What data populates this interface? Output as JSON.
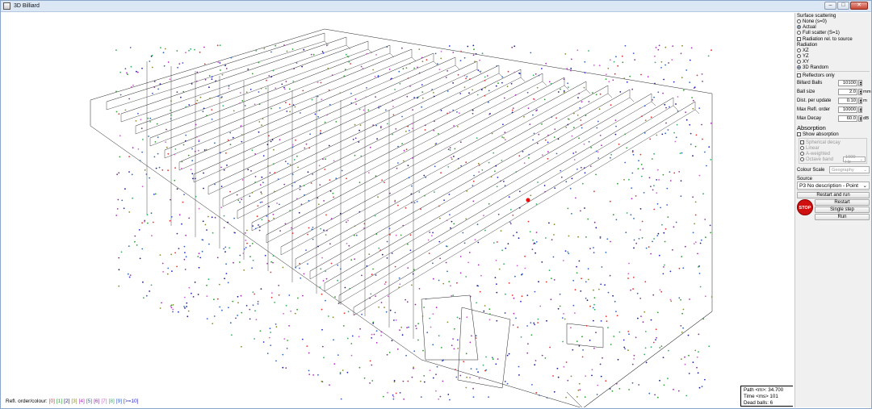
{
  "window": {
    "title": "3D Billiard",
    "minimize": "–",
    "maximize": "□",
    "close": "✕"
  },
  "legend": {
    "prefix": "Refl. order/colour:",
    "items": [
      {
        "label": "[0]",
        "color": "#e8302a"
      },
      {
        "label": "[1]",
        "color": "#2aa02a"
      },
      {
        "label": "[2]",
        "color": "#1a1a8c"
      },
      {
        "label": "[3]",
        "color": "#8a8a2a"
      },
      {
        "label": "[4]",
        "color": "#b02ac0"
      },
      {
        "label": "[5]",
        "color": "#2a6ac0"
      },
      {
        "label": "[6]",
        "color": "#7a3a8a"
      },
      {
        "label": "[7]",
        "color": "#d060d0"
      },
      {
        "label": "[8]",
        "color": "#30b060"
      },
      {
        "label": "[9]",
        "color": "#3a60d0"
      },
      {
        "label": "[>=10]",
        "color": "#2a2ad0"
      }
    ]
  },
  "stats": {
    "path": "Path <m>: 34.700",
    "time": "Time <ms> 101",
    "dead": "Dead balls:  6"
  },
  "panel": {
    "surface_title": "Surface scattering",
    "surface_options": [
      "None (s=0)",
      "Actual",
      "Full scatter (S=1)"
    ],
    "radiation_rel": "Radiation rel. to source",
    "radiation_title": "Radiation",
    "radiation_options": [
      "XZ",
      "YZ",
      "XY",
      "3D Random"
    ],
    "reflectors_only": "Reflectors only",
    "billiard_balls_label": "Billard Balls",
    "billiard_balls": "10100",
    "ball_size_label": "Ball size",
    "ball_size": "2.0",
    "ball_size_unit": "mm",
    "dist_label": "Dist. per update",
    "dist": "0.10",
    "dist_unit": "m",
    "max_refl_label": "Max Refl. order",
    "max_refl": "10000",
    "max_decay_label": "Max Decay",
    "max_decay": "60.0",
    "max_decay_unit": "dB",
    "absorption_title": "Absorption",
    "show_absorption": "Show absorption",
    "spherical_decay": "Spherical decay",
    "linear": "Linear",
    "a_weighted": "A-weighted",
    "octave_band": "Octave band",
    "octave_value": "1000 Hz",
    "colour_scale_label": "Colour Scale",
    "colour_scale_value": "Geography",
    "source_label": "Source",
    "source_value": "P3 No description - Point",
    "restart_and_run": "Restart and run",
    "restart": "Restart",
    "single_step": "Single step",
    "run": "Run",
    "stop": "STOP"
  }
}
